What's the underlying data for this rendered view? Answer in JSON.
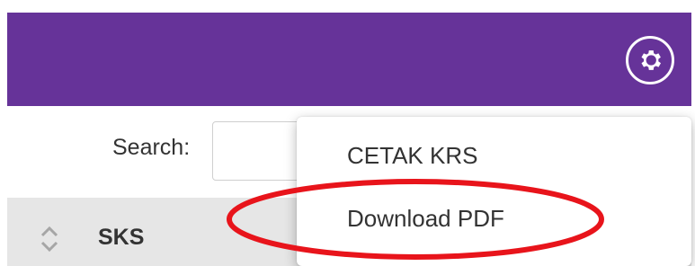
{
  "header": {
    "settings_icon": "gear-icon",
    "color": "#663399"
  },
  "toolbar": {
    "search_label": "Search:",
    "search_value": ""
  },
  "table": {
    "columns": [
      {
        "label": "SKS",
        "sort_icon": "sort-updown-icon"
      }
    ]
  },
  "dropdown_menu": {
    "items": [
      {
        "label": "CETAK KRS"
      },
      {
        "label": "Download PDF"
      }
    ],
    "highlighted_item": "Download PDF",
    "highlight_color": "#e8141b"
  }
}
